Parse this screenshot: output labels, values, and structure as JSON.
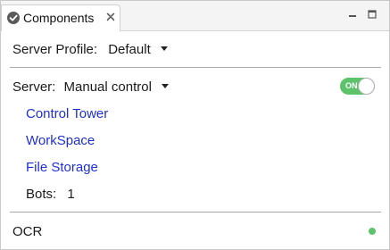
{
  "tab": {
    "title": "Components",
    "icon": "check-circle-icon"
  },
  "window_controls": {
    "minimize": "minimize-icon",
    "maximize": "maximize-icon"
  },
  "server_profile": {
    "label": "Server Profile:",
    "value": "Default"
  },
  "server": {
    "label": "Server:",
    "value": "Manual control",
    "toggle_text": "ON",
    "toggle_on": true
  },
  "links": [
    {
      "label": "Control Tower"
    },
    {
      "label": "WorkSpace"
    },
    {
      "label": "File Storage"
    }
  ],
  "bots": {
    "label": "Bots:",
    "value": "1"
  },
  "ocr": {
    "label": "OCR",
    "status": "online"
  },
  "colors": {
    "link": "#1e2fd8",
    "toggle_on": "#5cc36b",
    "status_ok": "#5cc36b"
  }
}
